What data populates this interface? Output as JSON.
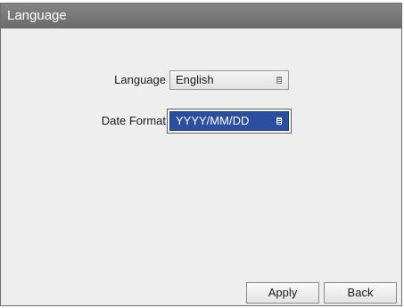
{
  "window": {
    "title": "Language"
  },
  "form": {
    "language": {
      "label": "Language",
      "value": "English"
    },
    "date_format": {
      "label": "Date Format",
      "value": "YYYY/MM/DD"
    }
  },
  "buttons": {
    "apply": "Apply",
    "back": "Back"
  },
  "colors": {
    "titlebar": "#777777",
    "focus_fill": "#2a4fa0",
    "panel": "#eeeeee"
  },
  "icons": {
    "select_arrow": "dropdown-indicator-icon"
  }
}
